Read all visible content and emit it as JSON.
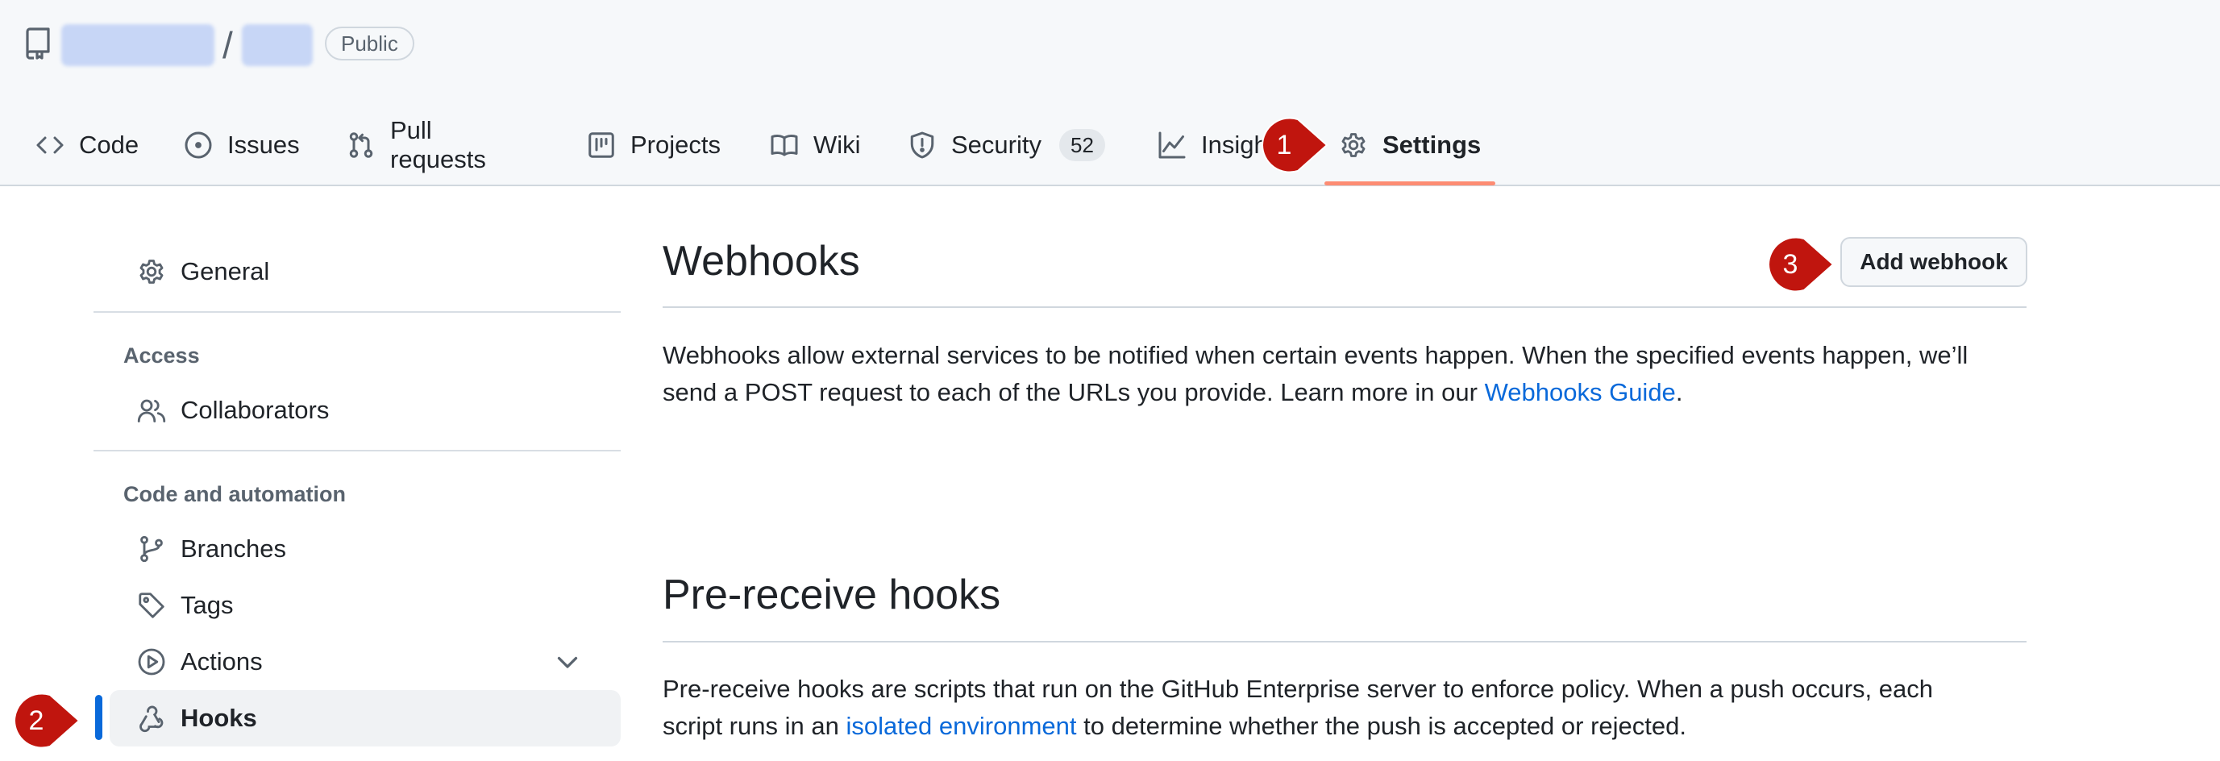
{
  "header": {
    "visibility_badge": "Public",
    "separator": "/"
  },
  "tabs": [
    {
      "label": "Code",
      "icon": "code-icon"
    },
    {
      "label": "Issues",
      "icon": "issue-opened-icon"
    },
    {
      "label": "Pull requests",
      "icon": "git-pull-request-icon"
    },
    {
      "label": "Projects",
      "icon": "table-icon"
    },
    {
      "label": "Wiki",
      "icon": "book-icon"
    },
    {
      "label": "Security",
      "icon": "shield-icon",
      "counter": "52"
    },
    {
      "label": "Insigh",
      "icon": "graph-icon"
    },
    {
      "label": "Settings",
      "icon": "gear-icon",
      "selected": true
    }
  ],
  "callouts": {
    "one": "1",
    "two": "2",
    "three": "3",
    "color": "#c0150e"
  },
  "sidebar": {
    "general": "General",
    "access_heading": "Access",
    "collaborators": "Collaborators",
    "code_heading": "Code and automation",
    "branches": "Branches",
    "tags": "Tags",
    "actions": "Actions",
    "hooks": "Hooks"
  },
  "webhooks": {
    "title": "Webhooks",
    "add_button": "Add webhook",
    "description_line1": "Webhooks allow external services to be notified when certain events happen. When the specified events happen, we’ll",
    "description_line2": "send a POST request to each of the URLs you provide. Learn more in our ",
    "guide_link": "Webhooks Guide",
    "period": "."
  },
  "prereceive": {
    "title": "Pre-receive hooks",
    "description_line1": "Pre-receive hooks are scripts that run on the GitHub Enterprise server to enforce policy. When a push occurs, each",
    "description_line2_a": "script runs in an ",
    "env_link": "isolated environment",
    "description_line2_b": " to determine whether the push is accepted or rejected."
  },
  "colors": {
    "accent_link": "#0969da",
    "selected_tab_underline": "#fd8c73",
    "active_sidebar_bar": "#0969da"
  }
}
